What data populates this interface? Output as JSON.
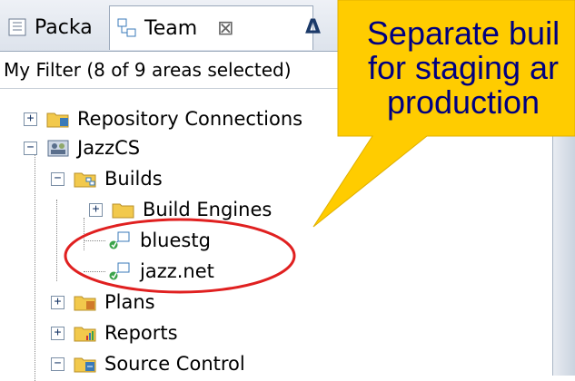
{
  "tabs": [
    {
      "label": "Packa"
    },
    {
      "label": "Team",
      "close": "⊠"
    },
    {
      "label": "Δ"
    }
  ],
  "filter_text": "My Filter (8 of 9 areas selected)",
  "tree": {
    "repository_connections": "Repository Connections",
    "jazzcs": "JazzCS",
    "builds": "Builds",
    "build_engines": "Build Engines",
    "bluestg": "bluestg",
    "jazz_net": "jazz.net",
    "plans": "Plans",
    "reports": "Reports",
    "source_control": "Source Control"
  },
  "callout": {
    "line1": "Separate buil",
    "line2": "for staging ar",
    "line3": "production"
  },
  "colors": {
    "callout_fill": "#ffcc00",
    "callout_text": "#000080",
    "oval": "#e02020",
    "folder": "#f2c94c"
  }
}
